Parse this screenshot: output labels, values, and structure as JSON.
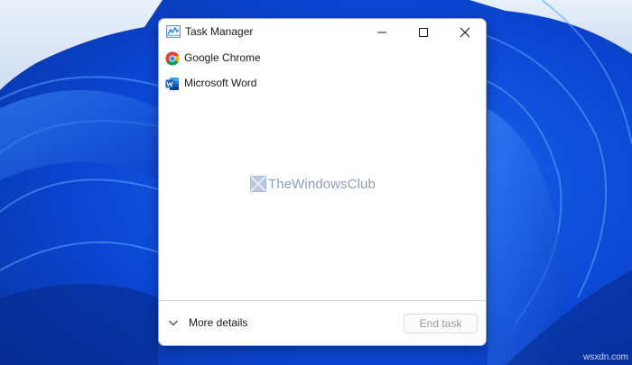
{
  "window": {
    "title": "Task Manager",
    "app_icon": "task-manager-chart-icon"
  },
  "titlebar_buttons": [
    {
      "name": "minimize",
      "icon": "minimize-icon"
    },
    {
      "name": "maximize",
      "icon": "maximize-icon"
    },
    {
      "name": "close",
      "icon": "close-icon"
    }
  ],
  "processes": [
    {
      "label": "Google Chrome",
      "icon": "chrome-icon"
    },
    {
      "label": "Microsoft Word",
      "icon": "word-icon"
    }
  ],
  "watermark": {
    "text": "TheWindowsClub"
  },
  "footer": {
    "more_details_label": "More details",
    "end_task_label": "End task",
    "end_task_enabled": false
  },
  "site_mark": "wsxdn.com",
  "colors": {
    "desktop": "#0a49d8",
    "window_bg": "#ffffff",
    "word_blue": "#2b579a",
    "disabled_text": "#9a9a9a"
  }
}
